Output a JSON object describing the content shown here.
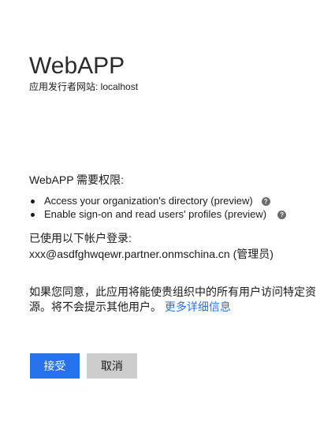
{
  "app": {
    "name": "WebAPP",
    "publisher_line": "应用发行者网站: localhost"
  },
  "permissions": {
    "heading": "WebAPP 需要权限:",
    "items": [
      {
        "label": "Access your organization's directory (preview)",
        "help_icon": "question-mark"
      },
      {
        "label": "Enable sign-on and read users' profiles (preview)",
        "help_icon": "question-mark"
      }
    ]
  },
  "account": {
    "signed_in_label": "已使用以下帐户登录:",
    "email_line": "xxx@asdfghwqewr.partner.onmschina.cn (管理员)"
  },
  "consent": {
    "text": "如果您同意，此应用将能使贵组织中的所有用户访问特定资源。将不会提示其他用户。",
    "more_link": "更多详细信息"
  },
  "buttons": {
    "accept_label": "接受",
    "cancel_label": "取消"
  },
  "colors": {
    "accent": "#2672ec",
    "cancel_bg": "#cccccc",
    "help_icon": "#6b6b6b"
  }
}
